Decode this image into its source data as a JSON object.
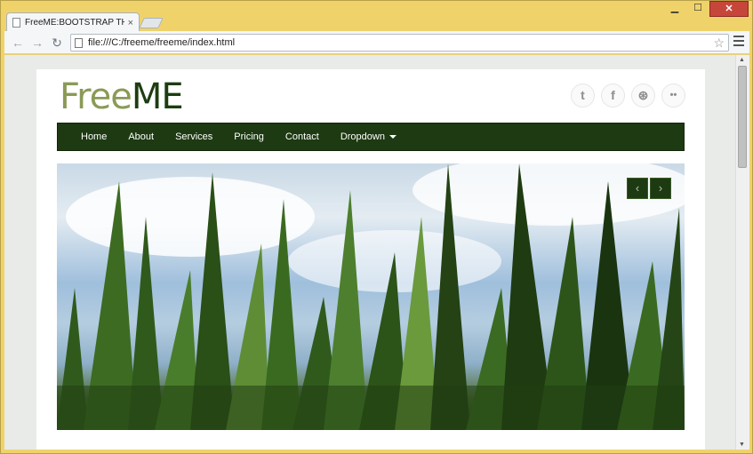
{
  "browser": {
    "tab_title": "FreeME:BOOTSTRAP THE",
    "tab_close": "×",
    "url": "file:///C:/freeme/freeme/index.html",
    "window_min": "▁",
    "window_max": "☐",
    "window_close": "✕"
  },
  "site": {
    "logo_part1": "Free",
    "logo_part2": "ME",
    "social": [
      {
        "icon": "twitter-icon",
        "glyph": "t"
      },
      {
        "icon": "facebook-icon",
        "glyph": "f"
      },
      {
        "icon": "dribbble-icon",
        "glyph": "⊛"
      },
      {
        "icon": "flickr-icon",
        "glyph": "••"
      }
    ],
    "nav": [
      "Home",
      "About",
      "Services",
      "Pricing",
      "Contact",
      "Dropdown"
    ],
    "slider": {
      "prev": "‹",
      "next": "›"
    }
  },
  "colors": {
    "brand_dark": "#1c3d12",
    "brand_light": "#8a9a56",
    "nav_bg": "#1d3a12"
  }
}
